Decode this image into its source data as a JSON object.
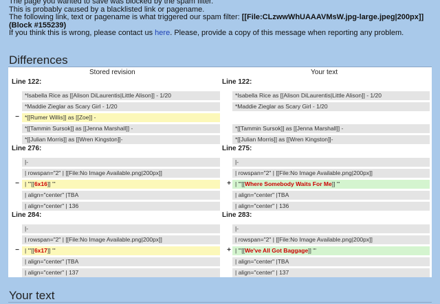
{
  "message": {
    "line1": "The page you wanted to save was blocked by the spam filter.",
    "line2": "This is probably caused by a blacklisted link or pagename.",
    "line3_prefix": "The following link, text or pagename is what triggered our spam filter: ",
    "line3_bold": "[[File:CLzwwWhUAAAVMsW.jpg-large.jpeg|200px]] (Block #155239)",
    "line4_prefix": "If you think this is wrong, please contact us ",
    "line4_link": "here",
    "line4_suffix": ". Please, provide a copy of this message when reporting any problem."
  },
  "differences_heading": "Differences",
  "columns": {
    "left": "Stored revision",
    "right": "Your text"
  },
  "blocks": [
    {
      "left_line": "Line 122:",
      "right_line": "Line 122:",
      "left_rows": [
        {
          "type": "ctx",
          "text": "*Isabella Rice as [[Alison DiLaurentis|Little Alison]] - 1/20"
        },
        {
          "type": "ctx",
          "text": "*Maddie Zieglar as Scary Girl - 1/20"
        },
        {
          "type": "del",
          "text": "*[[Rumer Willis]] as [[Zoe]] -"
        },
        {
          "type": "ctx",
          "text": "*[[Tammin Sursok]] as [[Jenna Marshall]] -"
        },
        {
          "type": "ctx",
          "text": "*[[Julian Morris]]  as [[Wren Kingston]]-"
        }
      ],
      "right_rows": [
        {
          "type": "ctx",
          "text": "*Isabella Rice as [[Alison DiLaurentis|Little Alison]] - 1/20"
        },
        {
          "type": "ctx",
          "text": "*Maddie Zieglar as Scary Girl - 1/20"
        },
        {
          "type": "blank",
          "text": ""
        },
        {
          "type": "ctx",
          "text": "*[[Tammin Sursok]] as [[Jenna Marshall]] -"
        },
        {
          "type": "ctx",
          "text": "*[[Julian Morris]]  as [[Wren Kingston]]-"
        }
      ]
    },
    {
      "left_line": "Line 276:",
      "right_line": "Line 275:",
      "left_rows": [
        {
          "type": "ctx",
          "text": "|-"
        },
        {
          "type": "ctx",
          "text": "| rowspan=\"2\" | [[File:No Image Available.png|200px]]"
        },
        {
          "type": "del",
          "pre": "| \"'[[",
          "hl": "6x16",
          "post": "]] '\""
        },
        {
          "type": "ctx",
          "text": "| align=\"center\" |TBA"
        },
        {
          "type": "ctx",
          "text": "| align=\"center\" | 136"
        }
      ],
      "right_rows": [
        {
          "type": "ctx",
          "text": "|-"
        },
        {
          "type": "ctx",
          "text": "| rowspan=\"2\" | [[File:No Image Available.png|200px]]"
        },
        {
          "type": "add",
          "pre": "| \"'[[",
          "hl": "Where Somebody Waits For Me",
          "post": "]] '\""
        },
        {
          "type": "ctx",
          "text": "| align=\"center\" |TBA"
        },
        {
          "type": "ctx",
          "text": "| align=\"center\" | 136"
        }
      ]
    },
    {
      "left_line": "Line 284:",
      "right_line": "Line 283:",
      "left_rows": [
        {
          "type": "ctx",
          "text": "|-"
        },
        {
          "type": "ctx",
          "text": "| rowspan=\"2\" | [[File:No Image Available.png|200px]]"
        },
        {
          "type": "del",
          "pre": "| \"'[[",
          "hl": "6x17",
          "post": "]] '\""
        },
        {
          "type": "ctx",
          "text": "| align=\"center\" |TBA"
        },
        {
          "type": "ctx",
          "text": "| align=\"center\" | 137"
        }
      ],
      "right_rows": [
        {
          "type": "ctx",
          "text": "|-"
        },
        {
          "type": "ctx",
          "text": "| rowspan=\"2\" | [[File:No Image Available.png|200px]]"
        },
        {
          "type": "add",
          "pre": "| \"'[[",
          "hl": "We've All Got Baggage",
          "post": "]] '\""
        },
        {
          "type": "ctx",
          "text": "| align=\"center\" |TBA"
        },
        {
          "type": "ctx",
          "text": "| align=\"center\" | 137"
        }
      ]
    }
  ],
  "markers": {
    "minus": "−",
    "plus": "+"
  },
  "your_text_heading": "Your text",
  "colors": {
    "background": "#a9c9ea",
    "deleted": "#fcf8b9",
    "added": "#d4f4cf",
    "context": "#e4e4e4",
    "highlight": "#cc0000",
    "link": "#1c3fb5"
  }
}
